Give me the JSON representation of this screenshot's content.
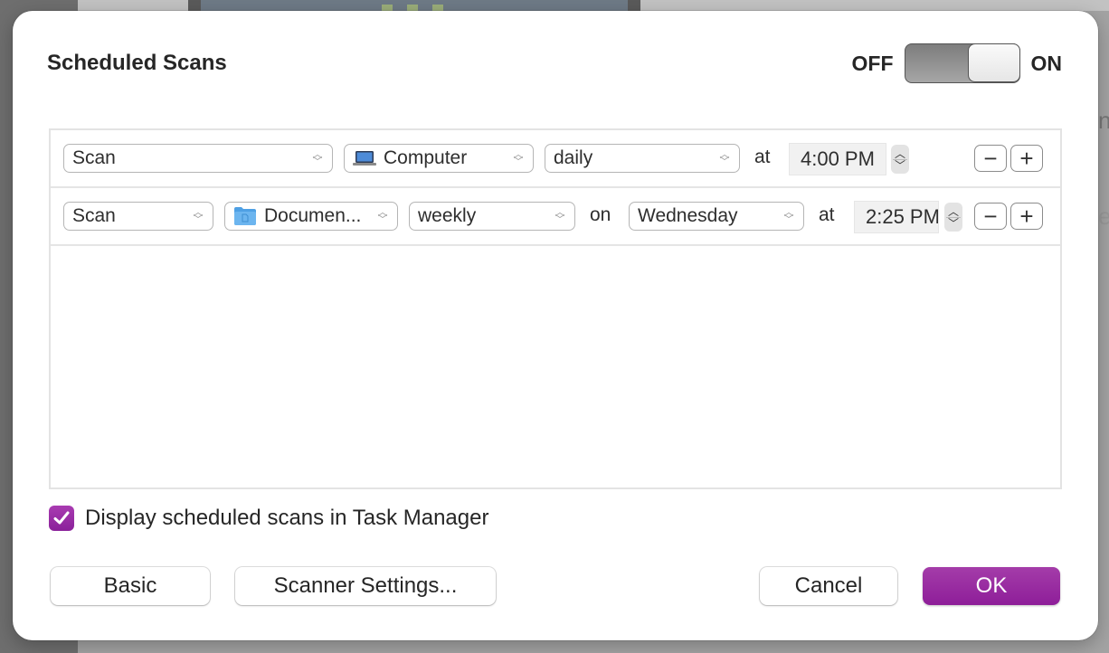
{
  "dialog": {
    "title": "Scheduled Scans",
    "toggle": {
      "off_label": "OFF",
      "on_label": "ON",
      "state": "on"
    }
  },
  "schedules": [
    {
      "action": "Scan",
      "target": {
        "label": "Computer",
        "icon": "laptop-icon"
      },
      "frequency": "daily",
      "at_label": "at",
      "time": "4:00 PM",
      "remove_label": "−",
      "add_label": "+"
    },
    {
      "action": "Scan",
      "target": {
        "label": "Documen...",
        "icon": "folder-icon"
      },
      "frequency": "weekly",
      "on_label": "on",
      "day": "Wednesday",
      "at_label": "at",
      "time": "2:25 PM",
      "remove_label": "−",
      "add_label": "+"
    }
  ],
  "options": {
    "display_in_task_manager": {
      "label": "Display scheduled scans in Task Manager",
      "checked": true
    }
  },
  "buttons": {
    "basic": "Basic",
    "scanner_settings": "Scanner Settings...",
    "cancel": "Cancel",
    "ok": "OK"
  },
  "colors": {
    "accent": "#9b2ca3"
  },
  "background": {
    "partial_text_1": "n",
    "partial_text_2": "e"
  }
}
